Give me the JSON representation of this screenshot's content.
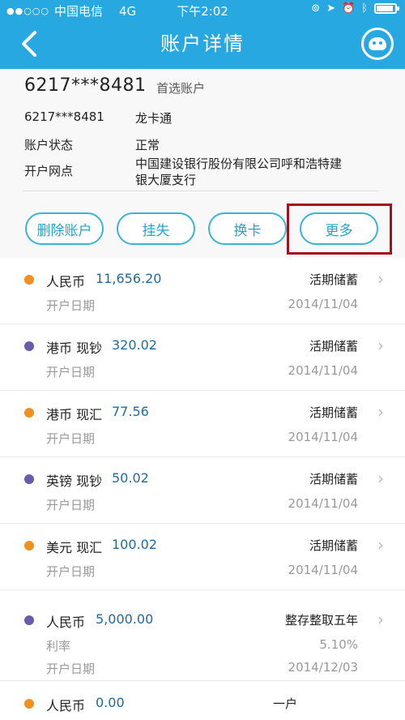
{
  "status_bar": {
    "carrier": "中国电信",
    "network": "4G",
    "time": "下午2:02",
    "battery_level": 0.9
  },
  "nav": {
    "title": "账户详情",
    "back_icon": "chevron-left-icon",
    "assistant_icon": "assistant-robot-icon"
  },
  "account": {
    "number": "6217***8481",
    "tag": "首选账户",
    "rows": [
      {
        "label": "6217***8481",
        "value": "龙卡通"
      },
      {
        "label": "账户状态",
        "value": "正常"
      },
      {
        "label": "开户网点",
        "value_line1": "中国建设银行股份有限公司呼和浩特建",
        "value_line2": "银大厦支行"
      }
    ]
  },
  "actions": {
    "delete": "删除账户",
    "report_loss": "挂失",
    "replace_card": "换卡",
    "more": "更多"
  },
  "items": [
    {
      "currency": "人民币",
      "amount": "11,656.20",
      "type": "活期储蓄",
      "sub_label": "开户日期",
      "sub_value": "2014/11/04",
      "dot": "#f0901e"
    },
    {
      "currency": "港币 现钞",
      "amount": "320.02",
      "type": "活期储蓄",
      "sub_label": "开户日期",
      "sub_value": "2014/11/04",
      "dot": "#6a5bb0"
    },
    {
      "currency": "港币 现汇",
      "amount": "77.56",
      "type": "活期储蓄",
      "sub_label": "开户日期",
      "sub_value": "2014/11/04",
      "dot": "#f0901e"
    },
    {
      "currency": "英镑 现钞",
      "amount": "50.02",
      "type": "活期储蓄",
      "sub_label": "开户日期",
      "sub_value": "2014/11/04",
      "dot": "#6a5bb0"
    },
    {
      "currency": "美元 现汇",
      "amount": "100.02",
      "type": "活期储蓄",
      "sub_label": "开户日期",
      "sub_value": "2014/11/04",
      "dot": "#f0901e"
    },
    {
      "currency": "人民币",
      "amount": "5,000.00",
      "type": "整存整取五年",
      "rate_label": "利率",
      "rate_value": "5.10%",
      "sub_label": "开户日期",
      "sub_value": "2014/12/03",
      "dot": "#6a5bb0"
    },
    {
      "currency": "人民币",
      "amount": "0.00",
      "type": "一户",
      "dot": "#f0901e"
    }
  ],
  "colors": {
    "brand": "#27a8e1",
    "button_border": "#3bb3d4",
    "highlight": "#a3121a",
    "amount": "#1d6aa5"
  }
}
